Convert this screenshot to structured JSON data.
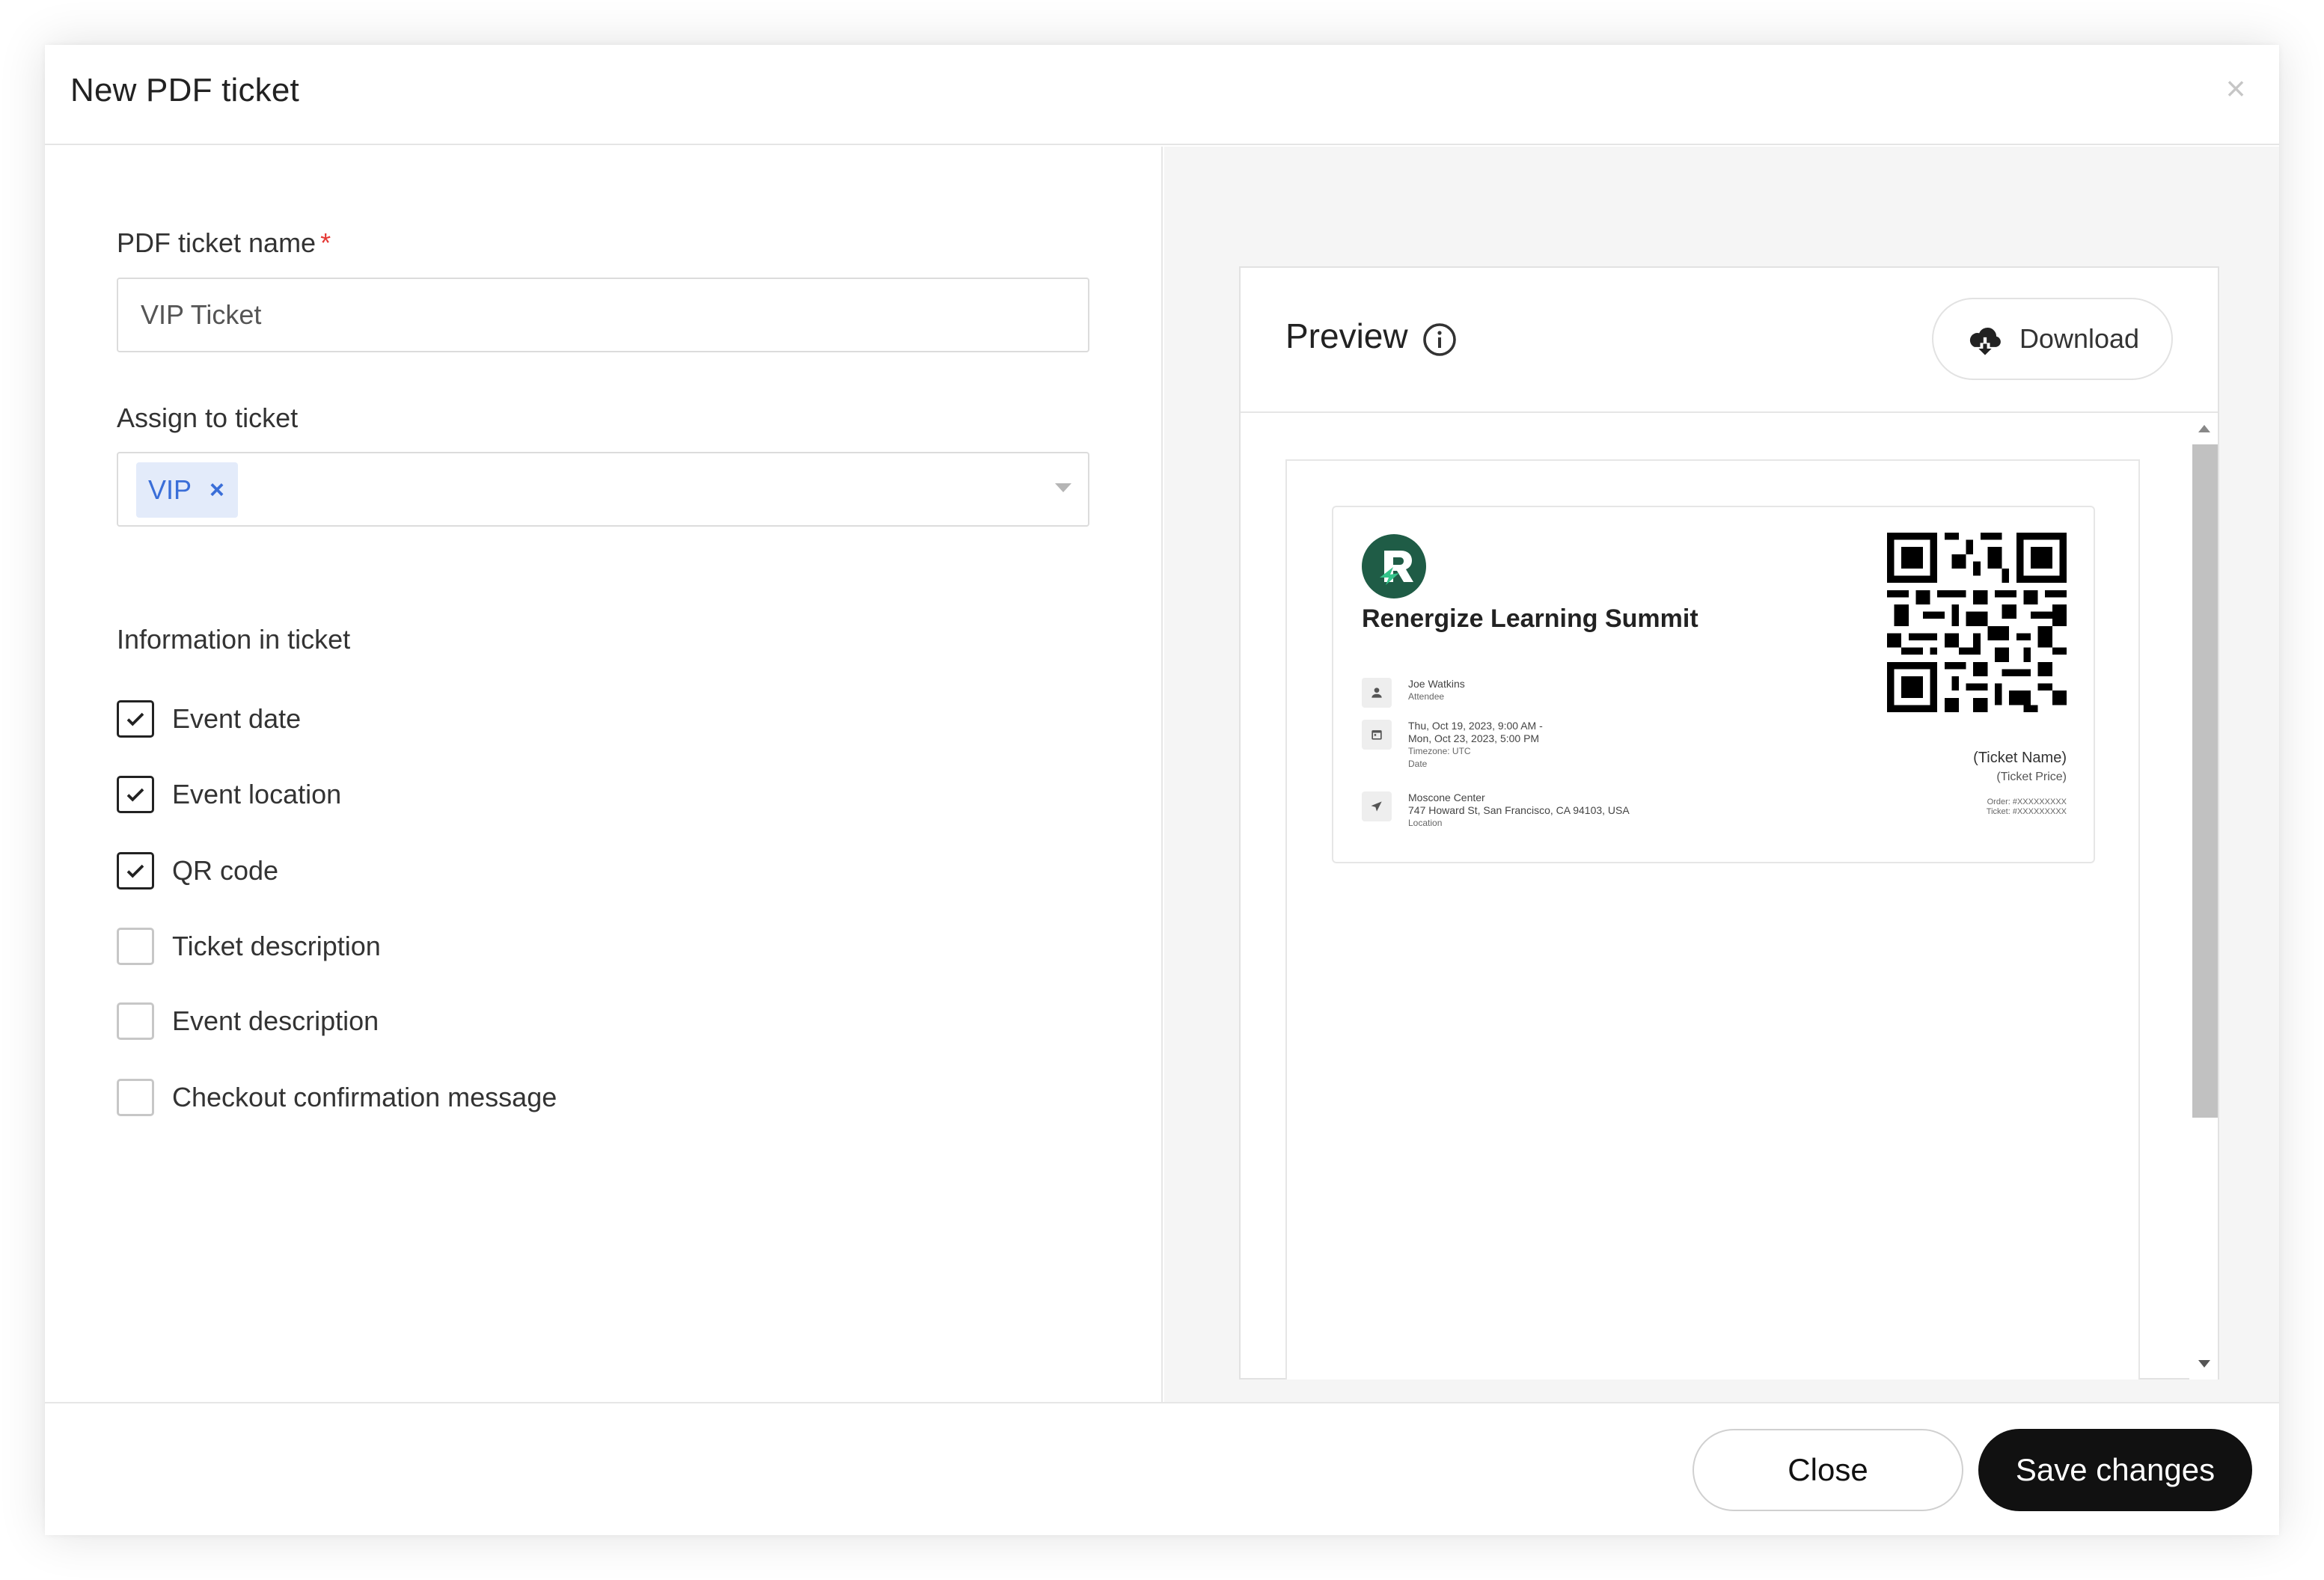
{
  "modal": {
    "title": "New PDF ticket",
    "close_icon": "close-icon"
  },
  "form": {
    "name_label": "PDF ticket name",
    "required_mark": "*",
    "name_value": "VIP Ticket",
    "assign_label": "Assign to ticket",
    "assigned_chip": "VIP",
    "chip_remove": "×",
    "info_label": "Information in ticket",
    "options": [
      {
        "label": "Event date",
        "checked": true
      },
      {
        "label": "Event location",
        "checked": true
      },
      {
        "label": "QR code",
        "checked": true
      },
      {
        "label": "Ticket description",
        "checked": false
      },
      {
        "label": "Event description",
        "checked": false
      },
      {
        "label": "Checkout confirmation message",
        "checked": false
      }
    ]
  },
  "preview": {
    "title": "Preview",
    "download_label": "Download",
    "ticket": {
      "event_name": "Renergize Learning Summit",
      "attendee_name": "Joe Watkins",
      "attendee_sub": "Attendee",
      "date_line1": "Thu, Oct 19, 2023,  9:00 AM -",
      "date_line2": "Mon, Oct 23, 2023,  5:00 PM",
      "date_timezone": "Timezone: UTC",
      "date_sub": "Date",
      "location_name": "Moscone Center",
      "location_address": "747 Howard St, San Francisco, CA 94103, USA",
      "location_sub": "Location",
      "ticket_name": "(Ticket Name)",
      "ticket_price": "(Ticket Price)",
      "order_line": "Order: #XXXXXXXXX",
      "ticket_line": "Ticket: #XXXXXXXXX"
    }
  },
  "footer": {
    "close_label": "Close",
    "save_label": "Save changes"
  },
  "colors": {
    "accent_chip_bg": "#e3ebfa",
    "accent_chip_text": "#3a6ed8",
    "primary_button": "#111111",
    "required": "#e53935",
    "logo_green": "#1f5c46"
  }
}
